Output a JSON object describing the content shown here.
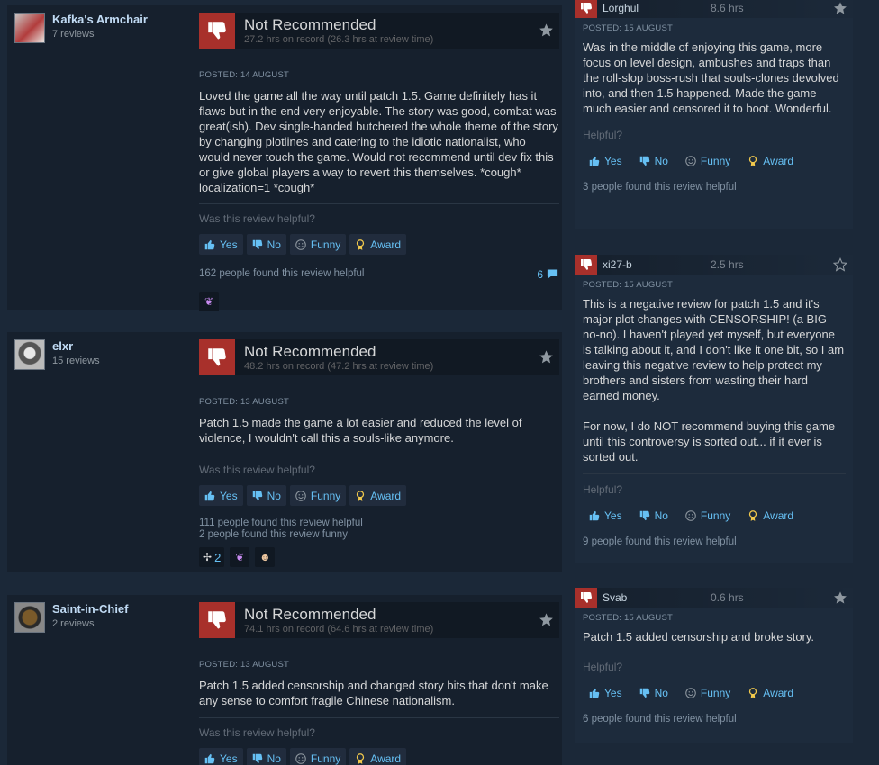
{
  "icons": {
    "thumbs_down": "thumbs-down-icon",
    "thumbs_up": "thumbs-up-icon",
    "smile": "smile-icon",
    "award": "award-icon",
    "star": "star-icon",
    "comment": "comment-icon"
  },
  "colors": {
    "page_bg": "#1b2838",
    "card_bg": "#16202d",
    "thumb_red": "#a8302b",
    "link_blue": "#66c0f4"
  },
  "buttons": {
    "yes": "Yes",
    "no": "No",
    "funny": "Funny",
    "award": "Award"
  },
  "helpful_question": "Was this review helpful?",
  "helpful_short": "Helpful?",
  "big_reviews": [
    {
      "author": "Kafka's Armchair",
      "review_count": "7 reviews",
      "verdict": "Not Recommended",
      "hours": "27.2 hrs on record (26.3 hrs at review time)",
      "posted": "POSTED: 14 AUGUST",
      "text": "Loved the game all the way until patch 1.5. Game definitely has it flaws but in the end very enjoyable. The story was good, combat was great(ish). Dev single-handed butchered the whole theme of the story by changing plotlines and catering to the idiotic nationalist, who would never touch the game. Would not recommend until dev fix this or give global players a way to revert this themselves. *cough* localization=1 *cough*",
      "helpful_count": "162 people found this review helpful",
      "comment_count": "6"
    },
    {
      "author": "elxr",
      "review_count": "15 reviews",
      "verdict": "Not Recommended",
      "hours": "48.2 hrs on record (47.2 hrs at review time)",
      "posted": "POSTED: 13 AUGUST",
      "text": "Patch 1.5 made the game a lot easier and reduced the level of violence, I wouldn't call this a souls-like anymore.",
      "helpful_count": "111 people found this review helpful",
      "funny_count": "2 people found this review funny",
      "award_count": "2"
    },
    {
      "author": "Saint-in-Chief",
      "review_count": "2 reviews",
      "verdict": "Not Recommended",
      "hours": "74.1 hrs on record (64.6 hrs at review time)",
      "posted": "POSTED: 13 AUGUST",
      "text": "Patch 1.5 added censorship and changed story bits that don't make any sense to comfort fragile Chinese nationalism."
    }
  ],
  "small_reviews": [
    {
      "author": "Lorghul",
      "hours": "8.6 hrs",
      "posted": "POSTED: 15 AUGUST",
      "text": "Was in the middle of enjoying this game, more focus on level design, ambushes and traps than the roll-slop boss-rush that souls-clones devolved into, and then 1.5 happened. Made the game much easier and censored it to boot. Wonderful.",
      "helpful_count": "3 people found this review helpful"
    },
    {
      "author": "xi27-b",
      "hours": "2.5 hrs",
      "posted": "POSTED: 15 AUGUST",
      "text": "This is a negative review for patch 1.5 and it's major plot changes with CENSORSHIP! (a BIG no-no). I haven't played yet myself, but everyone is talking about it, and I don't like it one bit, so I am leaving this negative review to help protect my brothers and sisters from wasting their hard earned money.",
      "text2": "For now, I do NOT recommend buying this game until this controversy is sorted out... if it ever is sorted out.",
      "helpful_count": "9 people found this review helpful"
    },
    {
      "author": "Svab",
      "hours": "0.6 hrs",
      "posted": "POSTED: 15 AUGUST",
      "text": "Patch 1.5 added censorship and broke story.",
      "helpful_count": "6 people found this review helpful"
    }
  ]
}
